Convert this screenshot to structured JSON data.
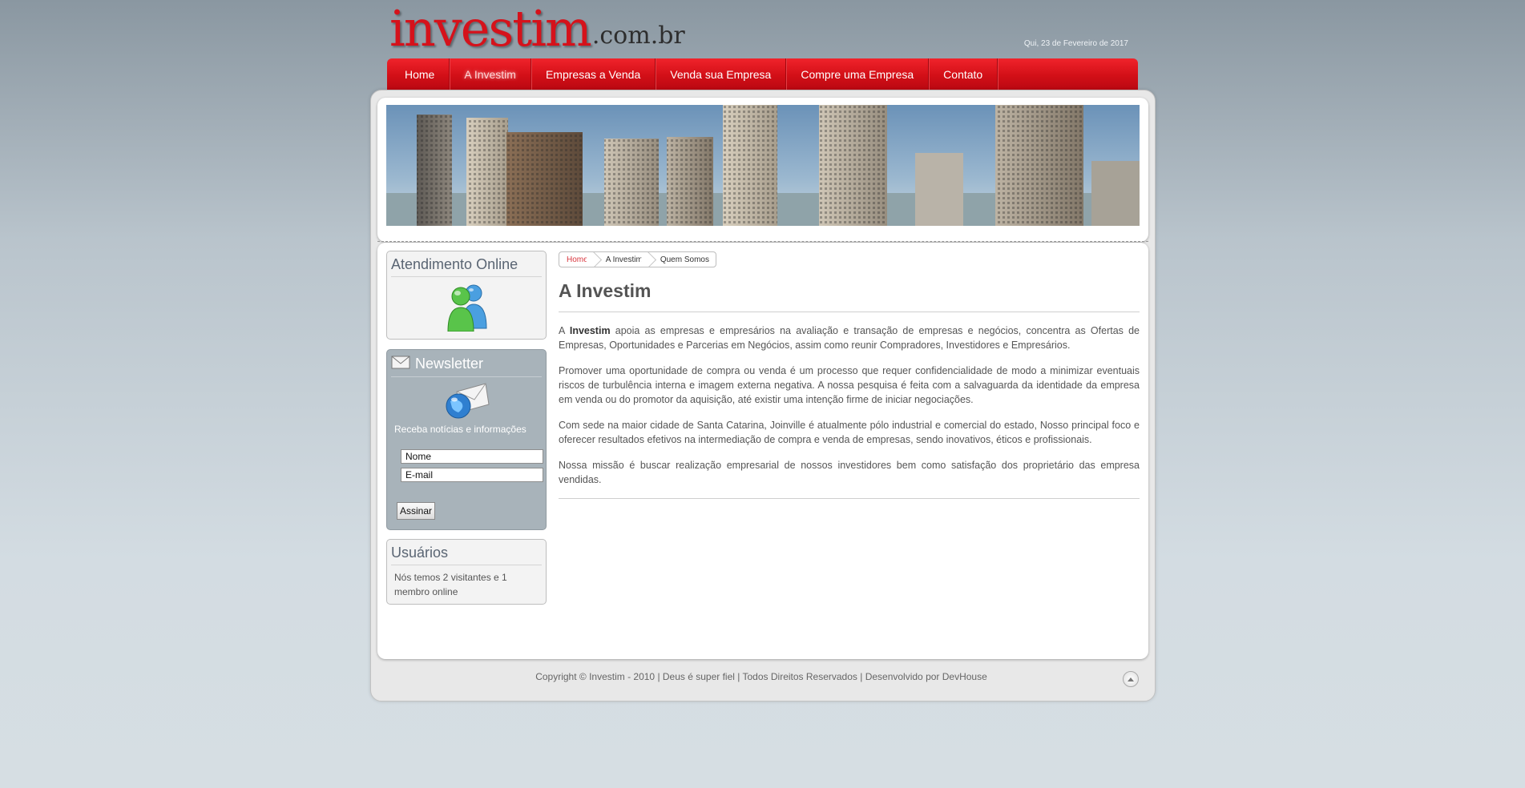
{
  "header": {
    "logo_brand": "investim",
    "logo_tld": ".com.br",
    "date": "Qui, 23 de Fevereiro de 2017"
  },
  "nav": {
    "items": [
      {
        "label": "Home"
      },
      {
        "label": "A Investim",
        "active": true
      },
      {
        "label": "Empresas a Venda"
      },
      {
        "label": "Venda sua Empresa"
      },
      {
        "label": "Compre uma Empresa"
      },
      {
        "label": "Contato"
      }
    ]
  },
  "sidebar": {
    "online": {
      "title": "Atendimento Online",
      "icon": "users-messenger-icon"
    },
    "newsletter": {
      "title": "Newsletter",
      "icon": "envelope-icon",
      "globe_icon": "globe-mail-icon",
      "text": "Receba notícias e informações",
      "name_value": "Nome",
      "email_value": "E-mail",
      "submit_label": "Assinar"
    },
    "users": {
      "title": "Usuários",
      "text": "Nós temos 2 visitantes e 1 membro online"
    }
  },
  "breadcrumb": [
    "Home",
    "A Investim",
    "Quem Somos"
  ],
  "article": {
    "title": "A Investim",
    "p1_prefix": "A ",
    "p1_strong": "Investim",
    "p1_rest": " apoia as empresas e empresários na avaliação e transação de empresas e negócios, concentra as Ofertas de Empresas, Oportunidades e Parcerias em Negócios, assim como reunir Compradores, Investidores e Empresários.",
    "p2": "Promover uma oportunidade de compra ou venda é um processo que requer confidencialidade de modo a minimizar eventuais riscos de turbulência interna e imagem externa negativa. A nossa pesquisa é feita com a salvaguarda da identidade da empresa em venda ou do promotor da aquisição, até existir uma intenção firme de iniciar negociações.",
    "p3": "Com sede na maior cidade de Santa Catarina, Joinville é atualmente pólo industrial e comercial do estado, Nosso principal foco e oferecer resultados efetivos na intermediação de compra e venda de empresas, sendo inovativos, éticos e profissionais.",
    "p4": "Nossa missão é buscar realização empresarial de nossos investidores bem como satisfação dos proprietário das empresa vendidas."
  },
  "footer": {
    "text": "Copyright © Investim - 2010 | Deus é super fiel | Todos Direitos Reservados | Desenvolvido por DevHouse",
    "top_icon": "arrow-up-icon"
  },
  "colors": {
    "brand_red": "#d5121b",
    "nav_red": "#d20f17"
  }
}
